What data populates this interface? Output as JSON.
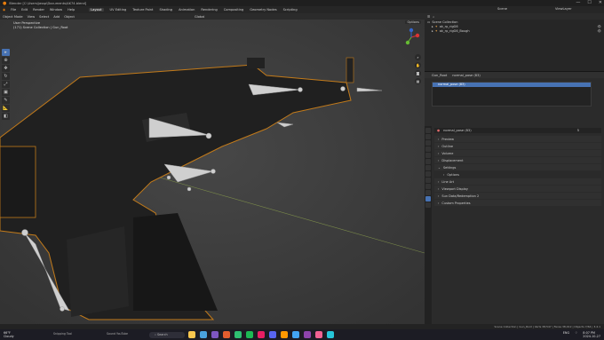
{
  "window": {
    "title": "Blender [C:\\Users\\jassp\\Documents\\AK74.blend]",
    "min": "—",
    "max": "☐",
    "close": "✕"
  },
  "menu": {
    "items": [
      "File",
      "Edit",
      "Render",
      "Window",
      "Help"
    ],
    "workspaces": [
      "Layout",
      "UV Editing",
      "Texture Paint",
      "Shading",
      "Animation",
      "Rendering",
      "Compositing",
      "Geometry Nodes",
      "Scripting"
    ],
    "active_workspace": "Layout",
    "scene": "Scene",
    "view_layer": "ViewLayer"
  },
  "viewport": {
    "header": [
      "Object Mode",
      "View",
      "Select",
      "Add",
      "Object"
    ],
    "transform": "Global",
    "options": "Options",
    "info_line1": "User Perspective",
    "info_line2": "(171) Scene Collection | Gun_Root",
    "tools": [
      "select-icon",
      "cursor-icon",
      "move-icon",
      "rotate-icon",
      "scale-icon",
      "transform-icon",
      "annotate-icon",
      "measure-icon",
      "add-cube-icon"
    ],
    "gizmo_axes": [
      "X",
      "Y",
      "Z"
    ]
  },
  "outliner": {
    "collection": "Scene Collection",
    "rows": [
      "ak_rp_rigG6",
      "ak_rp_rigG6_Bough"
    ]
  },
  "props_top": {
    "tabs": [
      "Gun_Root",
      "normal_pose (83)"
    ],
    "list_item": "normal_pose (83)"
  },
  "properties": {
    "datablock": "normal_pose (83)",
    "user_count": "5",
    "panels": [
      "Preview",
      "Outline",
      "Volume",
      "Displacement",
      "Settings"
    ],
    "sub_panel": "Options",
    "panels_after": [
      "Line Art",
      "Viewport Display",
      "Sun Data/Redemption 2",
      "Custom Properties"
    ]
  },
  "statusbar": {
    "text": "Scene Collection | Gun_Root | Verts 38,547 | Faces 38,012 | Objects 7/64 | 3.4.1"
  },
  "taskbar": {
    "weather_temp": "66°F",
    "weather_text": "Cloudy",
    "search": "Search",
    "apps": [
      "#f9c74f",
      "#4aa3df",
      "#7e57c2",
      "#e35d2f",
      "#2fbf71",
      "#1db954",
      "#e91e63",
      "#5865f2",
      "#ff9800",
      "#42a5f5",
      "#8e44ad",
      "#f06292",
      "#26c6da"
    ],
    "label1": "Snipping Tool",
    "label2": "Sound YouTube",
    "time": "8:07 PM",
    "date": "2024-10-27",
    "lang": "ENG"
  }
}
